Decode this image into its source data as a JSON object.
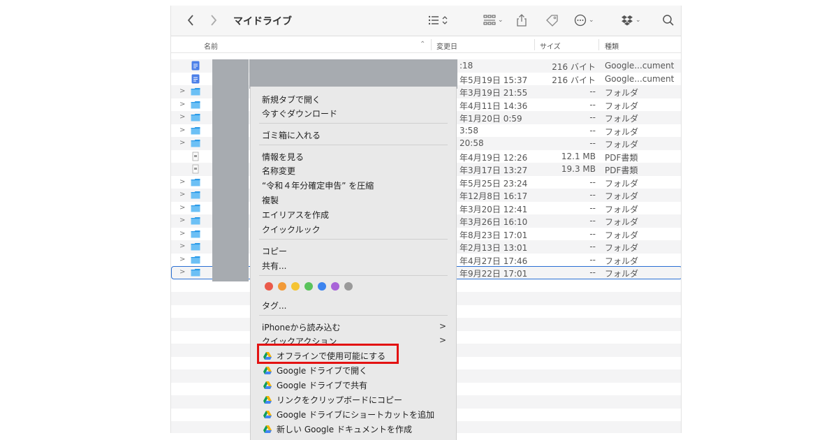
{
  "toolbar": {
    "title": "マイドライブ"
  },
  "columns": {
    "name": "名前",
    "modified": "変更日",
    "size": "サイズ",
    "kind": "種類"
  },
  "rows": [
    {
      "icon": "doc",
      "chev": "",
      "date": ":18",
      "size": "216 バイト",
      "kind": "Google...cument"
    },
    {
      "icon": "doc",
      "chev": "",
      "date": "年5月19日 15:37",
      "size": "216 バイト",
      "kind": "Google...cument"
    },
    {
      "icon": "folder",
      "chev": ">",
      "date": "年3月19日 21:55",
      "size": "--",
      "kind": "フォルダ"
    },
    {
      "icon": "folder",
      "chev": ">",
      "date": "年4月11日 14:36",
      "size": "--",
      "kind": "フォルダ"
    },
    {
      "icon": "folder",
      "chev": ">",
      "date": "年1月20日 0:59",
      "size": "--",
      "kind": "フォルダ"
    },
    {
      "icon": "folder",
      "chev": ">",
      "date": "3:58",
      "size": "--",
      "kind": "フォルダ"
    },
    {
      "icon": "folder",
      "chev": ">",
      "date": "20:58",
      "size": "--",
      "kind": "フォルダ"
    },
    {
      "icon": "pdf",
      "chev": "",
      "date": "年4月19日 12:26",
      "size": "12.1 MB",
      "kind": "PDF書類"
    },
    {
      "icon": "pdf",
      "chev": "",
      "date": "年3月17日 13:27",
      "size": "19.3 MB",
      "kind": "PDF書類"
    },
    {
      "icon": "folder",
      "chev": ">",
      "date": "年5月25日 23:24",
      "size": "--",
      "kind": "フォルダ"
    },
    {
      "icon": "folder",
      "chev": ">",
      "date": "年12月8日 16:17",
      "size": "--",
      "kind": "フォルダ"
    },
    {
      "icon": "folder",
      "chev": ">",
      "date": "年3月20日 12:41",
      "size": "--",
      "kind": "フォルダ"
    },
    {
      "icon": "folder",
      "chev": ">",
      "date": "年3月26日 16:10",
      "size": "--",
      "kind": "フォルダ"
    },
    {
      "icon": "folder",
      "chev": ">",
      "date": "年8月23日 17:01",
      "size": "--",
      "kind": "フォルダ"
    },
    {
      "icon": "folder",
      "chev": ">",
      "date": "年2月13日 13:01",
      "size": "--",
      "kind": "フォルダ"
    },
    {
      "icon": "folder",
      "chev": ">",
      "date": "年4月27日 17:46",
      "size": "--",
      "kind": "フォルダ"
    },
    {
      "icon": "folder",
      "chev": ">",
      "date": "年9月22日 17:01",
      "size": "--",
      "kind": "フォルダ",
      "selected": true
    }
  ],
  "context_menu": {
    "open_new_tab": "新規タブで開く",
    "download_now": "今すぐダウンロード",
    "move_to_trash": "ゴミ箱に入れる",
    "get_info": "情報を見る",
    "rename": "名称変更",
    "compress": "“令和４年分確定申告” を圧縮",
    "duplicate": "複製",
    "make_alias": "エイリアスを作成",
    "quick_look": "クイックルック",
    "copy": "コピー",
    "share": "共有...",
    "tags": "タグ...",
    "import_iphone": "iPhoneから読み込む",
    "quick_actions": "クイックアクション",
    "make_offline": "オフラインで使用可能にする",
    "open_gdrive": "Google ドライブで開く",
    "share_gdrive": "Google ドライブで共有",
    "copy_link": "リンクをクリップボードにコピー",
    "add_shortcut": "Google ドライブにショートカットを追加",
    "new_gdoc": "新しい Google ドキュメントを作成",
    "tag_colors": [
      "#ea5a4a",
      "#f29a37",
      "#f5c433",
      "#5ac35c",
      "#3d84ef",
      "#a864d8",
      "#9a9a9a"
    ]
  },
  "colors": {
    "highlight_box": "#e31212",
    "selection": "#2a6fd3",
    "folder": "#2b9ae8",
    "doc": "#4b7fe8"
  }
}
